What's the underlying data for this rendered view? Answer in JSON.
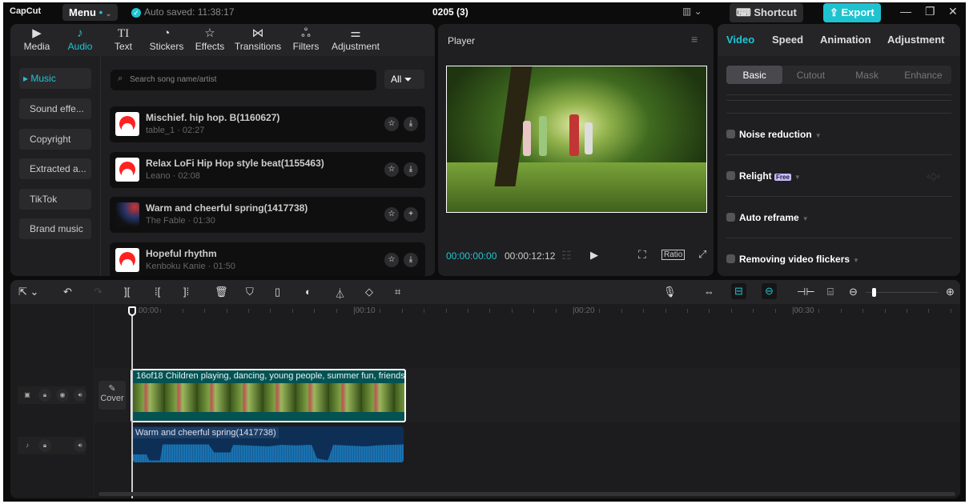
{
  "app": {
    "logo": "CapCut",
    "menu": "Menu",
    "auto_saved": "Auto saved: 11:38:17",
    "project_title": "0205 (3)",
    "shortcut": "Shortcut",
    "export": "Export",
    "accent": "#20c5d4"
  },
  "toolbar_tabs": [
    {
      "label": "Media",
      "icon": "media-icon"
    },
    {
      "label": "Audio",
      "icon": "audio-icon",
      "active": true
    },
    {
      "label": "Text",
      "icon": "text-icon"
    },
    {
      "label": "Stickers",
      "icon": "sticker-icon"
    },
    {
      "label": "Effects",
      "icon": "effects-icon"
    },
    {
      "label": "Transitions",
      "icon": "transitions-icon"
    },
    {
      "label": "Filters",
      "icon": "filters-icon"
    },
    {
      "label": "Adjustment",
      "icon": "adjustment-icon"
    }
  ],
  "audio_sidebar": [
    "Music",
    "Sound effe...",
    "Copyright",
    "Extracted a...",
    "TikTok",
    "Brand music"
  ],
  "search": {
    "placeholder": "Search song name/artist",
    "filter": "All"
  },
  "songs": [
    {
      "title": "Mischief. hip hop. B(1160627)",
      "meta": "table_1 · 02:27",
      "action": "download"
    },
    {
      "title": "Relax LoFi Hip Hop style beat(1155463)",
      "meta": "Leano · 02:08",
      "action": "download"
    },
    {
      "title": "Warm and cheerful spring(1417738)",
      "meta": "The Fable · 01:30",
      "action": "add"
    },
    {
      "title": "Hopeful rhythm",
      "meta": "Kenboku Kanie · 01:50",
      "action": "download"
    }
  ],
  "player": {
    "title": "Player",
    "current": "00:00:00:00",
    "total": "00:00:12:12",
    "ratio": "Ratio"
  },
  "right_panel": {
    "tabs": [
      "Video",
      "Speed",
      "Animation",
      "Adjustment"
    ],
    "subtabs": [
      "Basic",
      "Cutout",
      "Mask",
      "Enhance"
    ],
    "options": [
      "Noise reduction",
      "Relight",
      "Auto reframe",
      "Removing video flickers"
    ],
    "free_badge": "Free"
  },
  "timeline": {
    "ruler": [
      "00:00",
      "|00:10",
      "|00:20",
      "|00:30"
    ],
    "cover": "Cover",
    "video_clip": "16of18 Children playing, dancing, young people, summer fun, friends",
    "audio_clip": "Warm and cheerful spring(1417738)"
  }
}
